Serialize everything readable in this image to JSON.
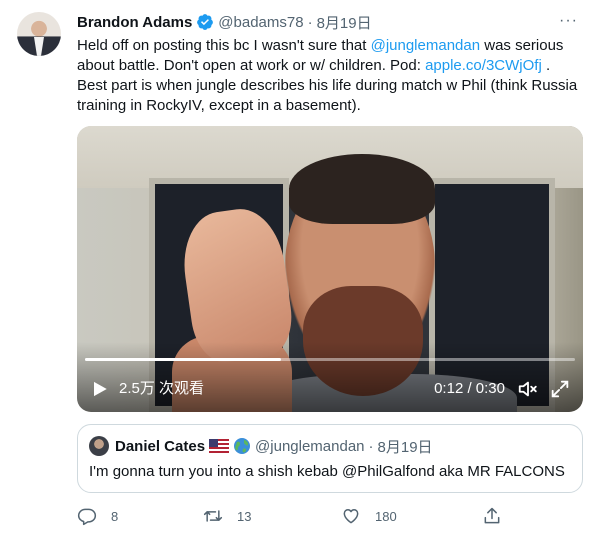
{
  "tweet": {
    "author_name": "Brandon Adams",
    "handle": "@badams78",
    "separator": "·",
    "date": "8月19日",
    "more": "···",
    "text_parts": {
      "t1": "Held off on posting this bc I wasn't sure that ",
      "mention": "@junglemandan",
      "t2": " was serious about battle. Don't open at work or w/ children. Pod: ",
      "link": "apple.co/3CWjOfj",
      "t3": " . Best part is when jungle describes his life during match w Phil (think Russia training in RockyIV, except in a basement)."
    }
  },
  "video": {
    "views": "2.5万 次观看",
    "time": "0:12 / 0:30",
    "progress": 0.4
  },
  "quote": {
    "author_name": "Daniel Cates",
    "handle": "@junglemandan",
    "separator": "·",
    "date": "8月19日",
    "text": "I'm gonna turn you into a shish kebab @PhilGalfond aka MR FALCONS"
  },
  "actions": {
    "replies": "8",
    "retweets": "13",
    "likes": "180"
  },
  "colors": {
    "accent": "#1d9bf0",
    "secondary_text": "#536471",
    "border": "#cfd9de"
  }
}
